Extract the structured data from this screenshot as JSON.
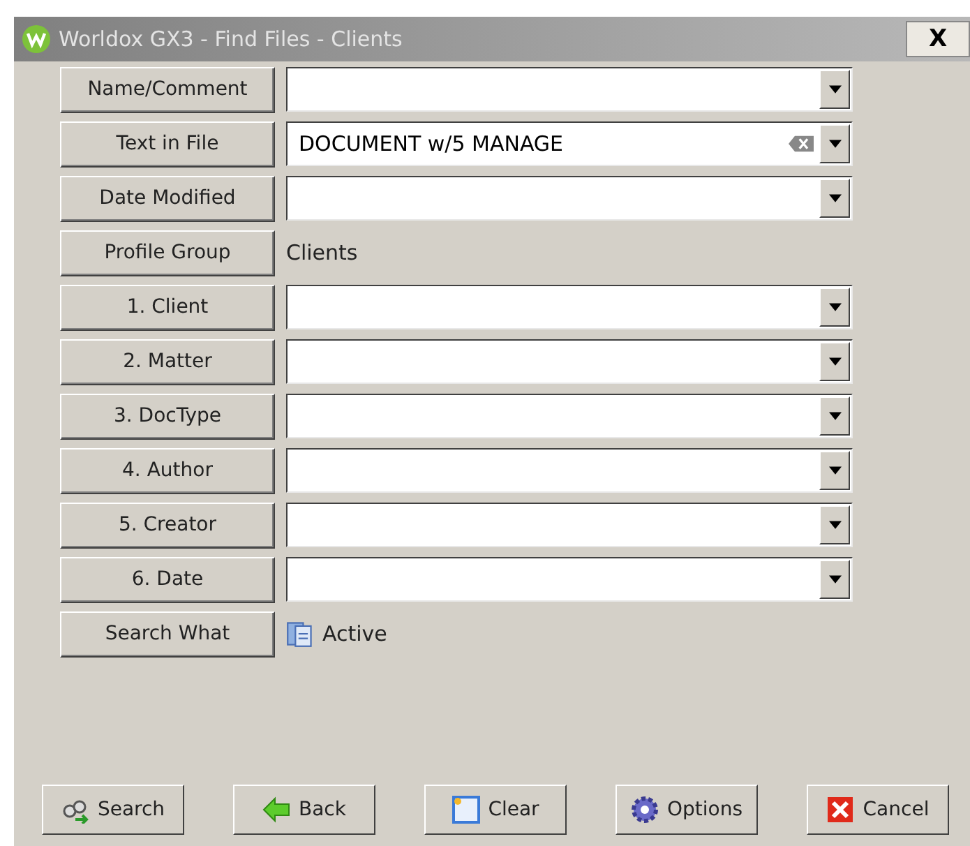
{
  "window": {
    "title": "Worldox GX3 - Find Files - Clients",
    "close": "X"
  },
  "fields": [
    {
      "label": "Name/Comment",
      "kind": "combo"
    },
    {
      "label": "Text in File",
      "kind": "combo",
      "value": "DOCUMENT w/5 MANAGE",
      "clearable": true
    },
    {
      "label": "Date Modified",
      "kind": "combo"
    },
    {
      "label": "Profile Group",
      "kind": "text",
      "value": "Clients"
    },
    {
      "label": "1. Client",
      "kind": "combo"
    },
    {
      "label": "2. Matter",
      "kind": "combo"
    },
    {
      "label": "3. DocType",
      "kind": "combo"
    },
    {
      "label": "4. Author",
      "kind": "combo"
    },
    {
      "label": "5. Creator",
      "kind": "combo"
    },
    {
      "label": "6. Date",
      "kind": "combo"
    },
    {
      "label": "Search What",
      "kind": "status",
      "value": "Active"
    }
  ],
  "buttons": [
    {
      "label": "Search",
      "kind": "search"
    },
    {
      "label": "Back",
      "kind": "back"
    },
    {
      "label": "Clear",
      "kind": "clear"
    },
    {
      "label": "Options",
      "kind": "options"
    },
    {
      "label": "Cancel",
      "kind": "cancel"
    }
  ]
}
